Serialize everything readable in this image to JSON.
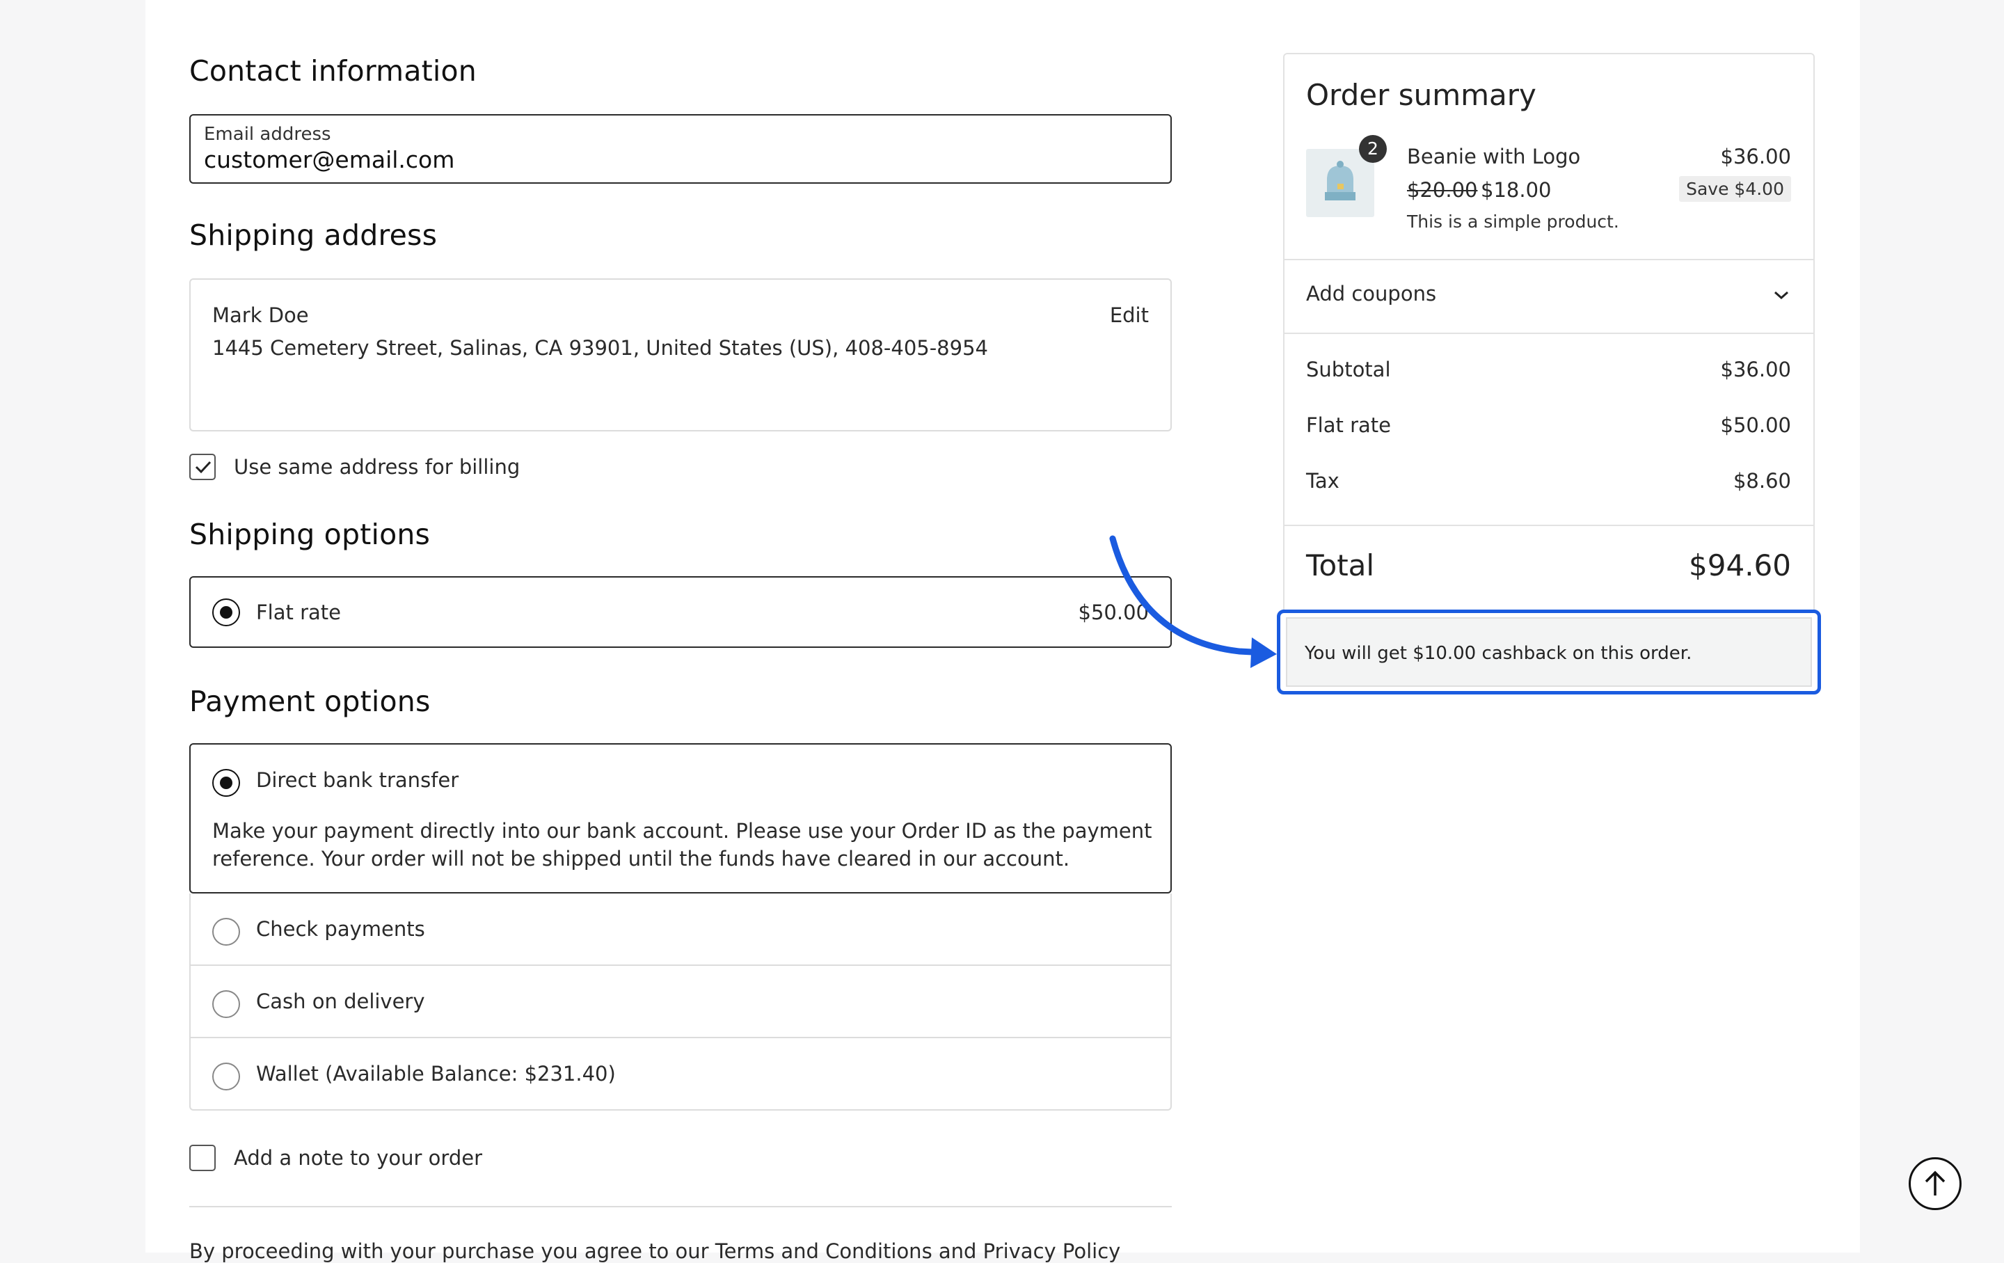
{
  "contact": {
    "heading": "Contact information",
    "email_label": "Email address",
    "email_value": "customer@email.com"
  },
  "shipping_address": {
    "heading": "Shipping address",
    "name": "Mark Doe",
    "address": "1445 Cemetery Street, Salinas, CA 93901, United States (US), 408-405-8954",
    "edit_label": "Edit"
  },
  "billing": {
    "same_address_label": "Use same address for billing",
    "checked": true
  },
  "shipping_options": {
    "heading": "Shipping options",
    "options": [
      {
        "label": "Flat rate",
        "price": "$50.00",
        "selected": true
      }
    ]
  },
  "payment_options": {
    "heading": "Payment options",
    "methods": [
      {
        "label": "Direct bank transfer",
        "selected": true,
        "description": "Make your payment directly into our bank account. Please use your Order ID as the payment reference. Your order will not be shipped until the funds have cleared in our account."
      },
      {
        "label": "Check payments",
        "selected": false
      },
      {
        "label": "Cash on delivery",
        "selected": false
      },
      {
        "label": "Wallet (Available Balance: $231.40)",
        "selected": false
      }
    ]
  },
  "order_note": {
    "label": "Add a note to your order",
    "checked": false
  },
  "terms_text": "By proceeding with your purchase you agree to our Terms and Conditions and Privacy Policy",
  "order_summary": {
    "heading": "Order summary",
    "item": {
      "name": "Beanie with Logo",
      "quantity": "2",
      "line_total": "$36.00",
      "regular_price": "$20.00",
      "sale_price": "$18.00",
      "save_label": "Save $4.00",
      "description": "This is a simple product."
    },
    "coupons_label": "Add coupons",
    "subtotal_label": "Subtotal",
    "subtotal_value": "$36.00",
    "shipping_label": "Flat rate",
    "shipping_value": "$50.00",
    "tax_label": "Tax",
    "tax_value": "$8.60",
    "total_label": "Total",
    "total_value": "$94.60"
  },
  "cashback_notice": "You will get $10.00 cashback on this order.",
  "colors": {
    "highlight": "#1a5be0",
    "border_dark": "#2b2b2b",
    "border_light": "#dcdcdc"
  },
  "icons": {
    "checkbox_check": "check-icon",
    "coupons_toggle": "chevron-down-icon",
    "scroll_top": "arrow-up-icon",
    "annotation": "curved-arrow-icon"
  }
}
